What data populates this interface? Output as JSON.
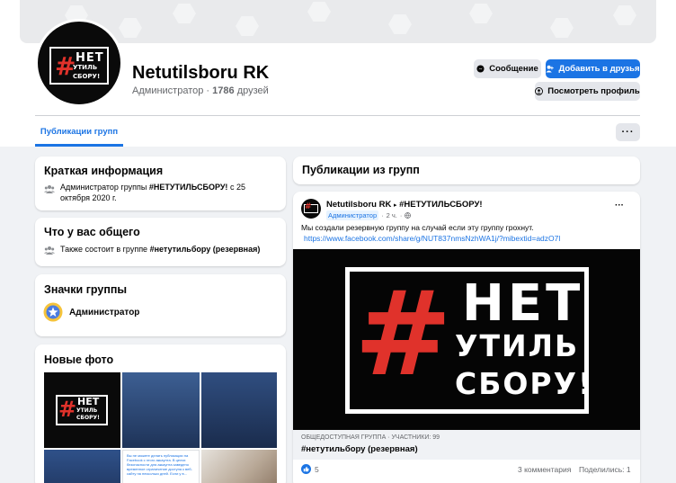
{
  "profile": {
    "name": "Netutilsboru RK",
    "role": "Администратор",
    "friends_count": "1786",
    "friends_label": "друзей",
    "logo_hash": "#",
    "logo_line1": "НЕТ",
    "logo_line2": "УТИЛЬ",
    "logo_line3": "СБОРУ!"
  },
  "actions": {
    "message": "Сообщение",
    "add_friend": "Добавить в друзья",
    "view_profile": "Посмотреть профиль"
  },
  "tabs": {
    "group_posts": "Публикации групп"
  },
  "more_label": "···",
  "about": {
    "title": "Краткая информация",
    "text_prefix": "Администратор группы ",
    "group": "#НЕТУТИЛЬСБОРУ!",
    "text_suffix": " с 25 октября 2020 г."
  },
  "common": {
    "title": "Что у вас общего",
    "text_prefix": "Также состоит в группе ",
    "group": "#нетутильбору (резервная)"
  },
  "badges": {
    "title": "Значки группы",
    "badge": "Администратор"
  },
  "photos": {
    "title": "Новые фото",
    "caption_snippet": "Вы не можете делать публикации на Facebook с этого аккаунта. В целях безопасности для аккаунта заведено временное ограничение доступа к веб-сайту на несколько дней. Если у в..."
  },
  "group_posts": {
    "title": "Публикации из групп"
  },
  "post": {
    "author": "Netutilsboru RK",
    "arrow": "▸",
    "group": "#НЕТУТИЛЬСБОРУ!",
    "role": "Администратор",
    "time": "2 ч.",
    "dots": "···",
    "text": "Мы создали резервную группу на случай если эту группу грохнут.",
    "link": "https://www.facebook.com/share/g/NUT837nmsNzhWA1j/?mibextid=adzO7l",
    "image_hash": "#",
    "image_line1": "НЕТ",
    "image_line2": "УТИЛЬ",
    "image_line3": "СБОРУ!",
    "share_meta": "ОБЩЕДОСТУПНАЯ ГРУППА · УЧАСТНИКИ: 99",
    "share_title": "#нетутильбору (резервная)",
    "likes": "5",
    "comments": "3 комментария",
    "shares": "Поделились: 1"
  },
  "colors": {
    "accent": "#1b74e4",
    "background": "#f0f2f5",
    "logo_red": "#e0322b"
  }
}
